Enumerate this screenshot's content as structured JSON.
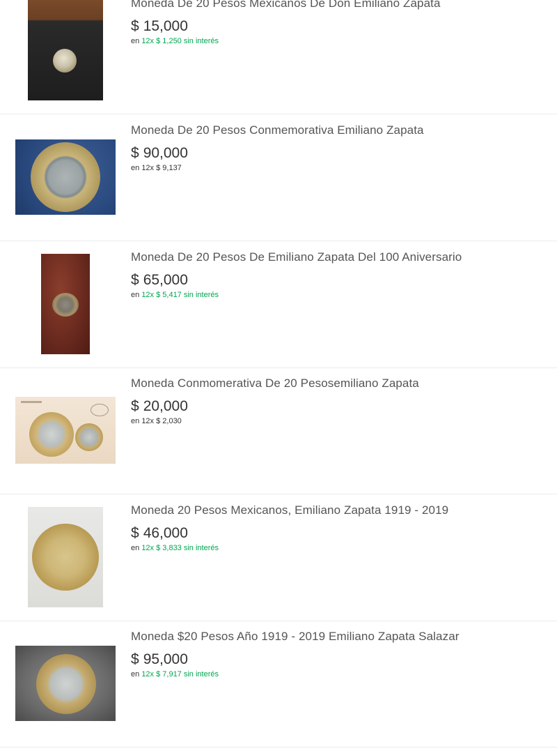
{
  "listings": [
    {
      "title": "Moneda De 20 Pesos Mexicanos De Don Emiliano Zapata",
      "currency": "$",
      "price": "15,000",
      "inst_prefix": "en",
      "inst_plan": "12x $ 1,250 sin interés",
      "interest_free": true
    },
    {
      "title": "Moneda De 20 Pesos Conmemorativa Emiliano Zapata",
      "currency": "$",
      "price": "90,000",
      "inst_prefix": "en",
      "inst_plan": "12x $ 9,137",
      "interest_free": false
    },
    {
      "title": "Moneda De 20 Pesos De Emiliano Zapata Del 100 Aniversario",
      "currency": "$",
      "price": "65,000",
      "inst_prefix": "en",
      "inst_plan": "12x $ 5,417 sin interés",
      "interest_free": true
    },
    {
      "title": "Moneda Conmomerativa De 20 Pesosemiliano Zapata",
      "currency": "$",
      "price": "20,000",
      "inst_prefix": "en",
      "inst_plan": "12x $ 2,030",
      "interest_free": false
    },
    {
      "title": "Moneda 20 Pesos Mexicanos, Emiliano Zapata 1919 - 2019",
      "currency": "$",
      "price": "46,000",
      "inst_prefix": "en",
      "inst_plan": "12x $ 3,833 sin interés",
      "interest_free": true
    },
    {
      "title": "Moneda $20 Pesos Año 1919 - 2019 Emiliano Zapata Salazar",
      "currency": "$",
      "price": "95,000",
      "inst_prefix": "en",
      "inst_plan": "12x $ 7,917 sin interés",
      "interest_free": true
    }
  ],
  "colors": {
    "installment_green": "#00a650",
    "divider": "#ebebeb"
  }
}
